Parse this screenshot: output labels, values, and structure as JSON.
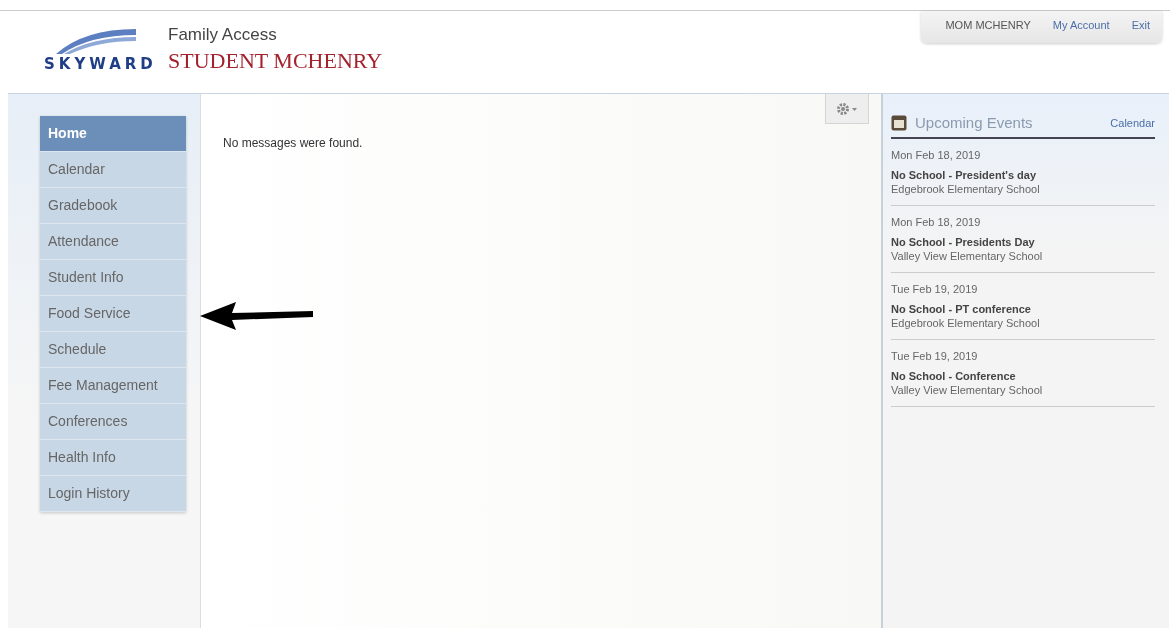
{
  "logo": {
    "text": "SKYWARD"
  },
  "header": {
    "app_title": "Family Access",
    "student_name": "STUDENT MCHENRY"
  },
  "user_bar": {
    "user": "MOM MCHENRY",
    "links": [
      "My Account",
      "Exit"
    ]
  },
  "nav": [
    {
      "label": "Home",
      "selected": true
    },
    {
      "label": "Calendar",
      "selected": false
    },
    {
      "label": "Gradebook",
      "selected": false
    },
    {
      "label": "Attendance",
      "selected": false
    },
    {
      "label": "Student Info",
      "selected": false
    },
    {
      "label": "Food Service",
      "selected": false
    },
    {
      "label": "Schedule",
      "selected": false
    },
    {
      "label": "Fee Management",
      "selected": false
    },
    {
      "label": "Conferences",
      "selected": false
    },
    {
      "label": "Health Info",
      "selected": false
    },
    {
      "label": "Login History",
      "selected": false
    }
  ],
  "messages": {
    "text": "No messages were found."
  },
  "events": {
    "title": "Upcoming Events",
    "link": "Calendar",
    "items": [
      {
        "date": "Mon Feb 18, 2019",
        "title": "No School - President's day",
        "school": "Edgebrook Elementary School"
      },
      {
        "date": "Mon Feb 18, 2019",
        "title": "No School - Presidents Day",
        "school": "Valley View Elementary School"
      },
      {
        "date": "Tue Feb 19, 2019",
        "title": "No School - PT conference",
        "school": "Edgebrook Elementary School"
      },
      {
        "date": "Tue Feb 19, 2019",
        "title": "No School - Conference",
        "school": "Valley View Elementary School"
      }
    ]
  }
}
